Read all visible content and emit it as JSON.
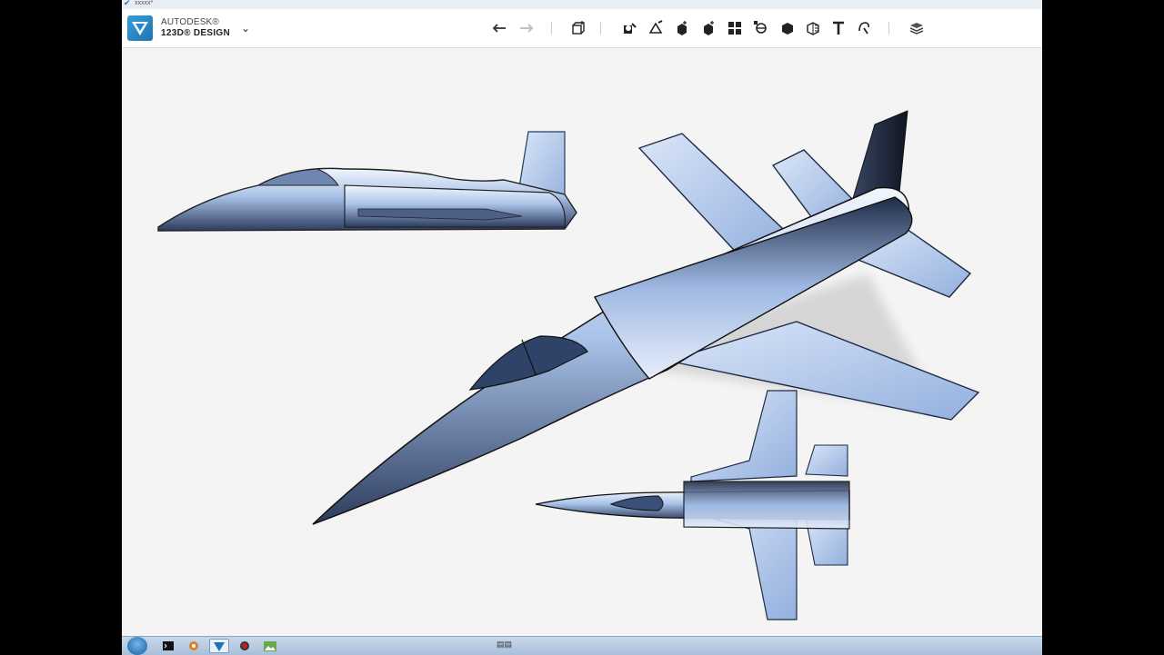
{
  "window": {
    "title_text": "xxxxx*"
  },
  "app": {
    "brand_line1": "AUTODESK®",
    "brand_line2": "123D® DESIGN"
  },
  "toolbar": {
    "tools": [
      {
        "name": "undo-icon",
        "interactable": true
      },
      {
        "name": "redo-icon",
        "interactable": true
      },
      {
        "name": "primitives-icon",
        "interactable": true
      },
      {
        "name": "sketch-icon",
        "interactable": true
      },
      {
        "name": "construct-icon",
        "interactable": true
      },
      {
        "name": "modify-icon",
        "interactable": true
      },
      {
        "name": "pattern-icon",
        "interactable": true
      },
      {
        "name": "grouping-icon",
        "interactable": true
      },
      {
        "name": "combine-icon",
        "interactable": true
      },
      {
        "name": "measure-icon",
        "interactable": true
      },
      {
        "name": "text-icon",
        "interactable": true
      },
      {
        "name": "snap-icon",
        "interactable": true
      },
      {
        "name": "material-icon",
        "interactable": true
      }
    ]
  },
  "colors": {
    "plane_light": "#dfe9f8",
    "plane_mid": "#9cb8e2",
    "plane_dark": "#2a3a5c",
    "background": "#f4f4f4",
    "brand_blue": "#1e73b3"
  },
  "taskbar": {
    "items": [
      "start-button",
      "cmd-icon",
      "tools-icon",
      "123d-design-icon",
      "record-icon",
      "image-viewer-icon"
    ],
    "tray_text": "▤▤"
  }
}
